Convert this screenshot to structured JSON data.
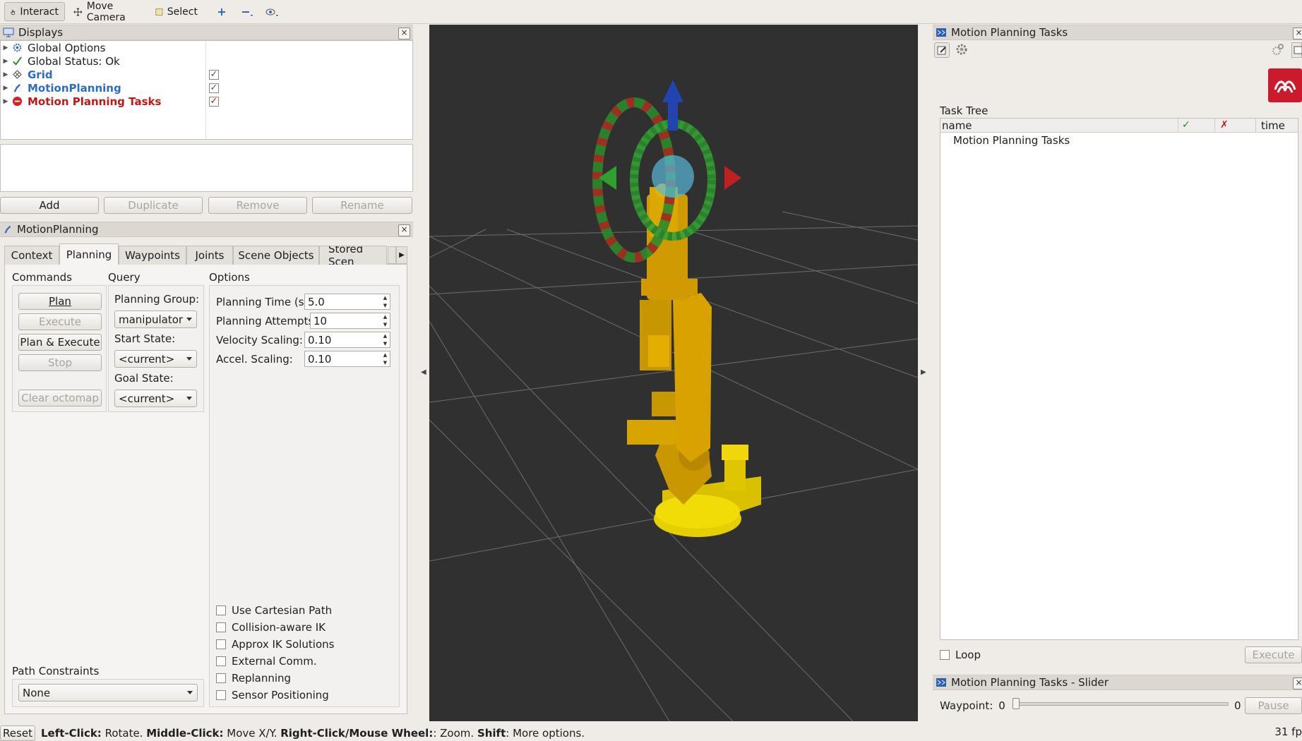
{
  "toolbar": {
    "interact": "Interact",
    "move_camera": "Move Camera",
    "select": "Select"
  },
  "displays": {
    "title": "Displays",
    "items": [
      {
        "label": "Global Options",
        "color": "#1e1e1e"
      },
      {
        "label": "Global Status: Ok",
        "color": "#1e1e1e"
      },
      {
        "label": "Grid",
        "color": "#2b6cc4"
      },
      {
        "label": "MotionPlanning",
        "color": "#2b6cc4"
      },
      {
        "label": "Motion Planning Tasks",
        "color": "#c01818"
      }
    ],
    "buttons": {
      "add": "Add",
      "duplicate": "Duplicate",
      "remove": "Remove",
      "rename": "Rename"
    }
  },
  "motion_planning": {
    "title": "MotionPlanning",
    "tabs": [
      "Context",
      "Planning",
      "Waypoints",
      "Joints",
      "Scene Objects",
      "Stored Scen"
    ],
    "active_tab": "Planning",
    "commands": {
      "label": "Commands",
      "plan": "Plan",
      "execute": "Execute",
      "plan_execute": "Plan & Execute",
      "stop": "Stop",
      "clear_octomap": "Clear octomap"
    },
    "query": {
      "label": "Query",
      "planning_group_label": "Planning Group:",
      "planning_group": "manipulator",
      "start_state_label": "Start State:",
      "start_state": "<current>",
      "goal_state_label": "Goal State:",
      "goal_state": "<current>"
    },
    "options": {
      "label": "Options",
      "planning_time_label": "Planning Time (s):",
      "planning_time": "5.0",
      "planning_attempts_label": "Planning Attempts:",
      "planning_attempts": "10",
      "velocity_scaling_label": "Velocity Scaling:",
      "velocity_scaling": "0.10",
      "accel_scaling_label": "Accel. Scaling:",
      "accel_scaling": "0.10",
      "checkboxes": [
        "Use Cartesian Path",
        "Collision-aware IK",
        "Approx IK Solutions",
        "External Comm.",
        "Replanning",
        "Sensor Positioning"
      ]
    },
    "path_constraints": {
      "label": "Path Constraints",
      "value": "None"
    }
  },
  "tasks_panel": {
    "title": "Motion Planning Tasks",
    "task_tree_label": "Task Tree",
    "columns": {
      "name": "name",
      "ok": "✓",
      "fail": "✗",
      "time": "time"
    },
    "rows": [
      "Motion Planning Tasks"
    ],
    "loop_label": "Loop",
    "execute_label": "Execute"
  },
  "slider_panel": {
    "title": "Motion Planning Tasks - Slider",
    "waypoint_label": "Waypoint:",
    "waypoint_value": "0",
    "max_value": "0",
    "pause_label": "Pause"
  },
  "statusbar": {
    "reset": "Reset",
    "hint_left_click": "Left-Click:",
    "hint_rotate": " Rotate. ",
    "hint_middle_click": "Middle-Click:",
    "hint_move": " Move X/Y. ",
    "hint_right_click": "Right-Click/Mouse Wheel:",
    "hint_zoom": ": Zoom. ",
    "hint_shift": "Shift",
    "hint_more": ": More options.",
    "fps": "31 fp"
  }
}
